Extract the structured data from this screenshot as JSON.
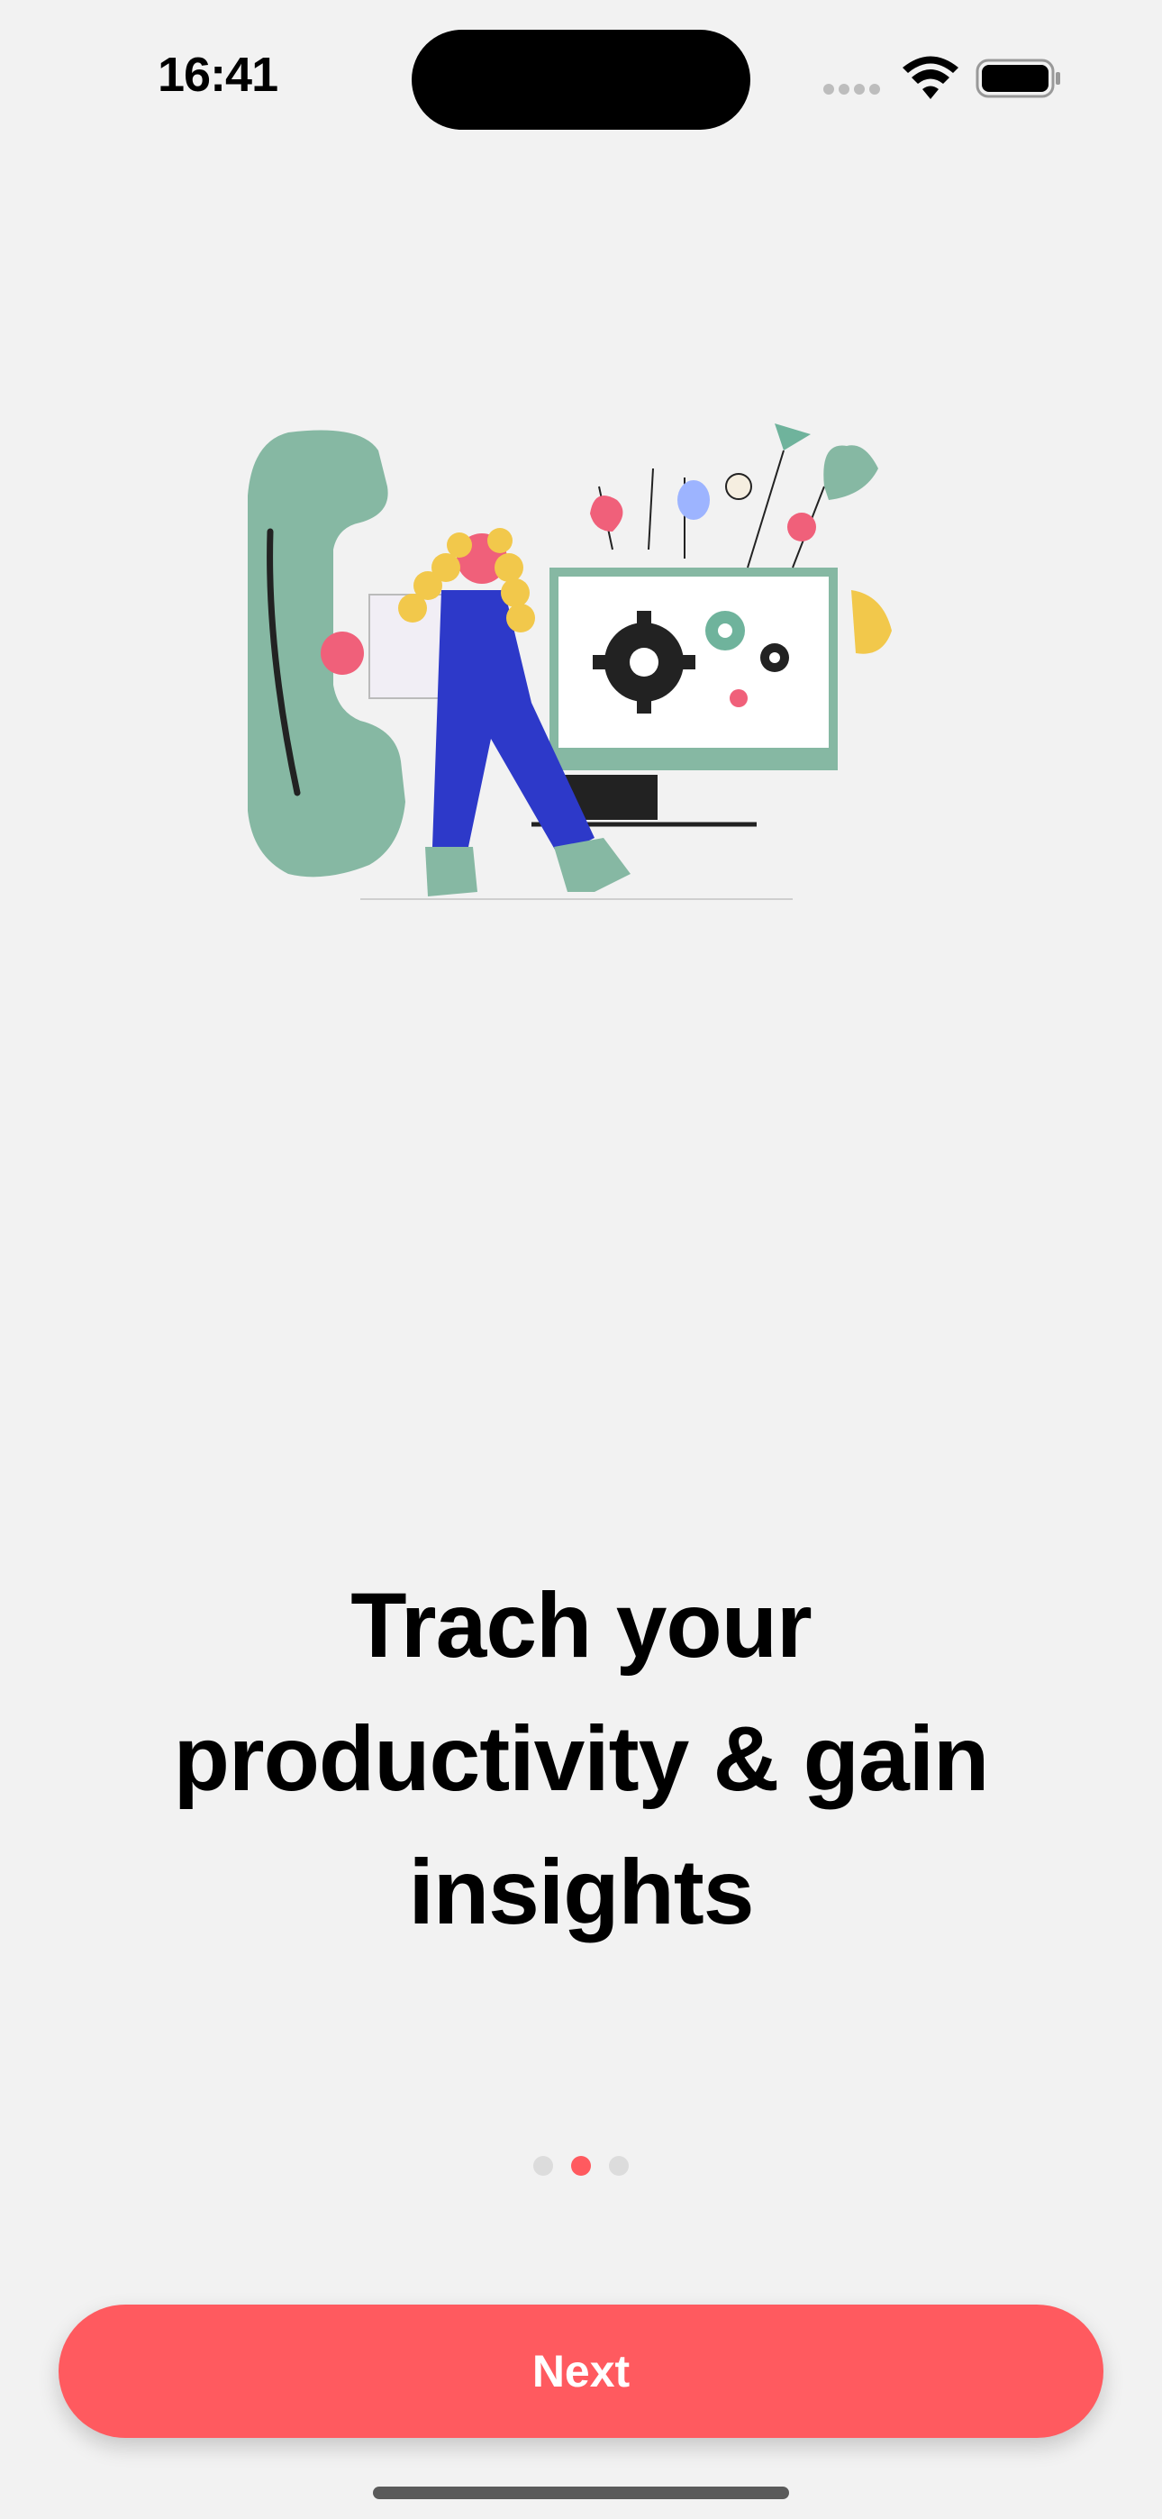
{
  "status_bar": {
    "time": "16:41",
    "icons": [
      "cellular-signal-icon",
      "wifi-icon",
      "battery-icon"
    ]
  },
  "illustration": {
    "name": "onboarding-illustration",
    "description": ""
  },
  "onboarding": {
    "title": "Trach your\nproductivity  & gain\ninsights",
    "page_count": 3,
    "current_page": 2
  },
  "actions": {
    "next_label": "Next"
  },
  "colors": {
    "background": "#f2f2f2",
    "accent": "#ff5a5f",
    "illustration_green": "#86b8a3",
    "illustration_blue": "#2d39c9",
    "illustration_yellow": "#f2c84b"
  }
}
